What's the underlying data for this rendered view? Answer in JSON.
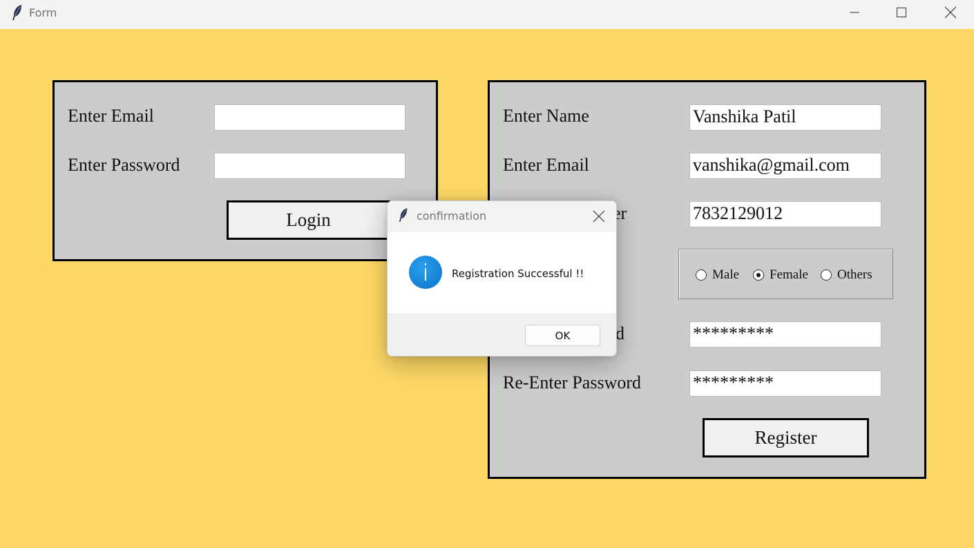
{
  "window": {
    "title": "Form"
  },
  "login": {
    "email_label": "Enter Email",
    "email_value": "",
    "password_label": "Enter Password",
    "password_value": "",
    "login_button": "Login"
  },
  "register": {
    "name_label": "Enter Name",
    "name_value": "Vanshika Patil",
    "email_label": "Enter Email",
    "email_value": "vanshika@gmail.com",
    "phone_label_visible": "er",
    "phone_value": "7832129012",
    "gender_options": [
      {
        "label": "Male",
        "selected": false
      },
      {
        "label": "Female",
        "selected": true
      },
      {
        "label": "Others",
        "selected": false
      }
    ],
    "password_label_visible": "d",
    "password_value": "*********",
    "reenter_label": "Re-Enter Password",
    "reenter_value": "*********",
    "register_button": "Register"
  },
  "dialog": {
    "title": "confirmation",
    "message": "Registration Successful !!",
    "ok_button": "OK",
    "icon": "info-icon"
  },
  "colors": {
    "background": "#fed866",
    "panel": "#cccccc",
    "info_blue": "#0b73c8"
  }
}
